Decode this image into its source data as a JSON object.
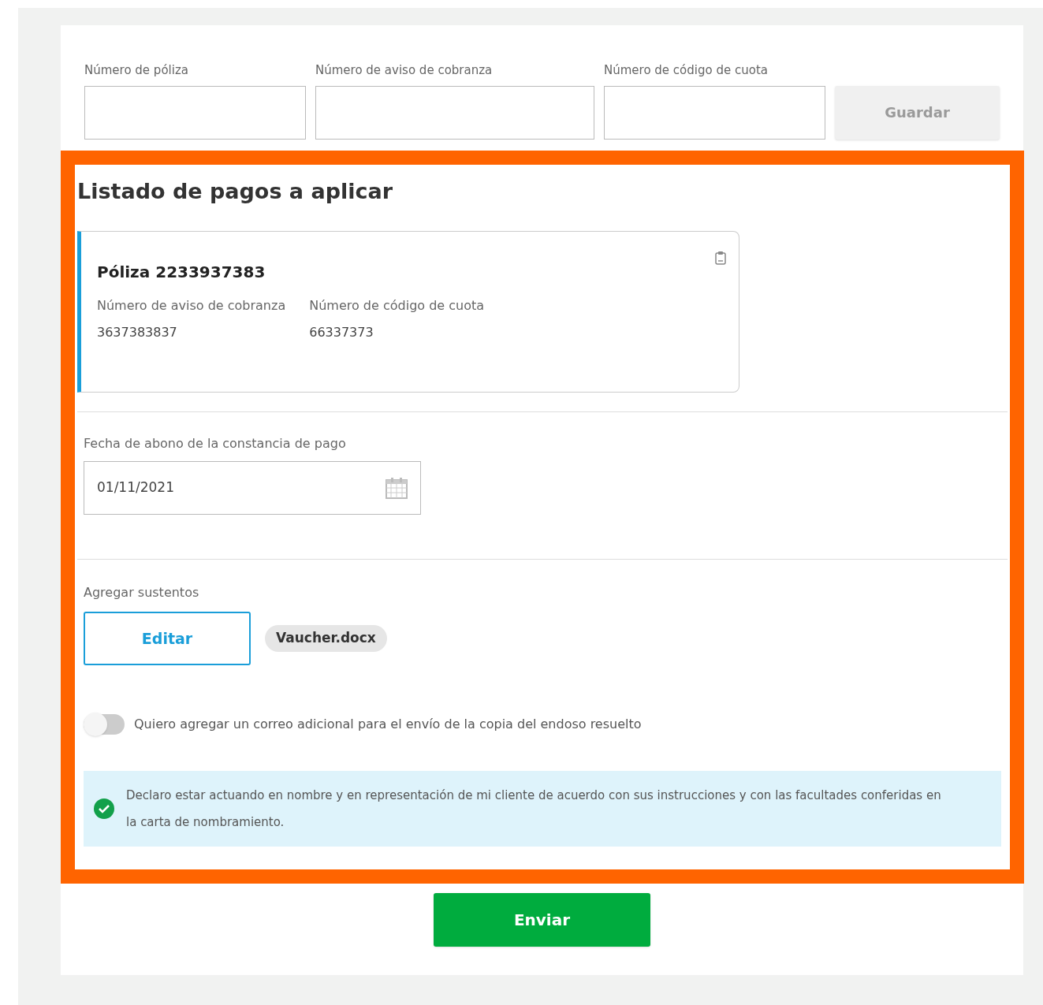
{
  "search_form": {
    "fields": [
      {
        "label": "Número de póliza"
      },
      {
        "label": "Número de aviso de cobranza"
      },
      {
        "label": "Número de código de cuota"
      }
    ],
    "save_button": {
      "label": "Guardar",
      "disabled": true
    }
  },
  "payments": {
    "title": "Listado de pagos a aplicar",
    "cards": [
      {
        "title": "Póliza 2233937383",
        "details": [
          {
            "label": "Número de aviso de cobranza",
            "value": "3637383837"
          },
          {
            "label": "Número de código de cuota",
            "value": "66337373"
          }
        ]
      }
    ],
    "date_field": {
      "label": "Fecha de abono de la constancia de pago",
      "value": "01/11/2021"
    },
    "attachments": {
      "label": "Agregar sustentos",
      "button": "Editar",
      "files": [
        "Vaucher.docx"
      ]
    },
    "extra_email": {
      "label": "Quiero agregar un correo adicional para el envío de la copia del endoso resuelto",
      "on": false
    },
    "declaration": {
      "text": "Declaro estar actuando en nombre y en representación de mi cliente de acuerdo con sus instrucciones y con las facultades conferidas en la carta de nombramiento.",
      "checked": true
    }
  },
  "submit_button": "Enviar"
}
